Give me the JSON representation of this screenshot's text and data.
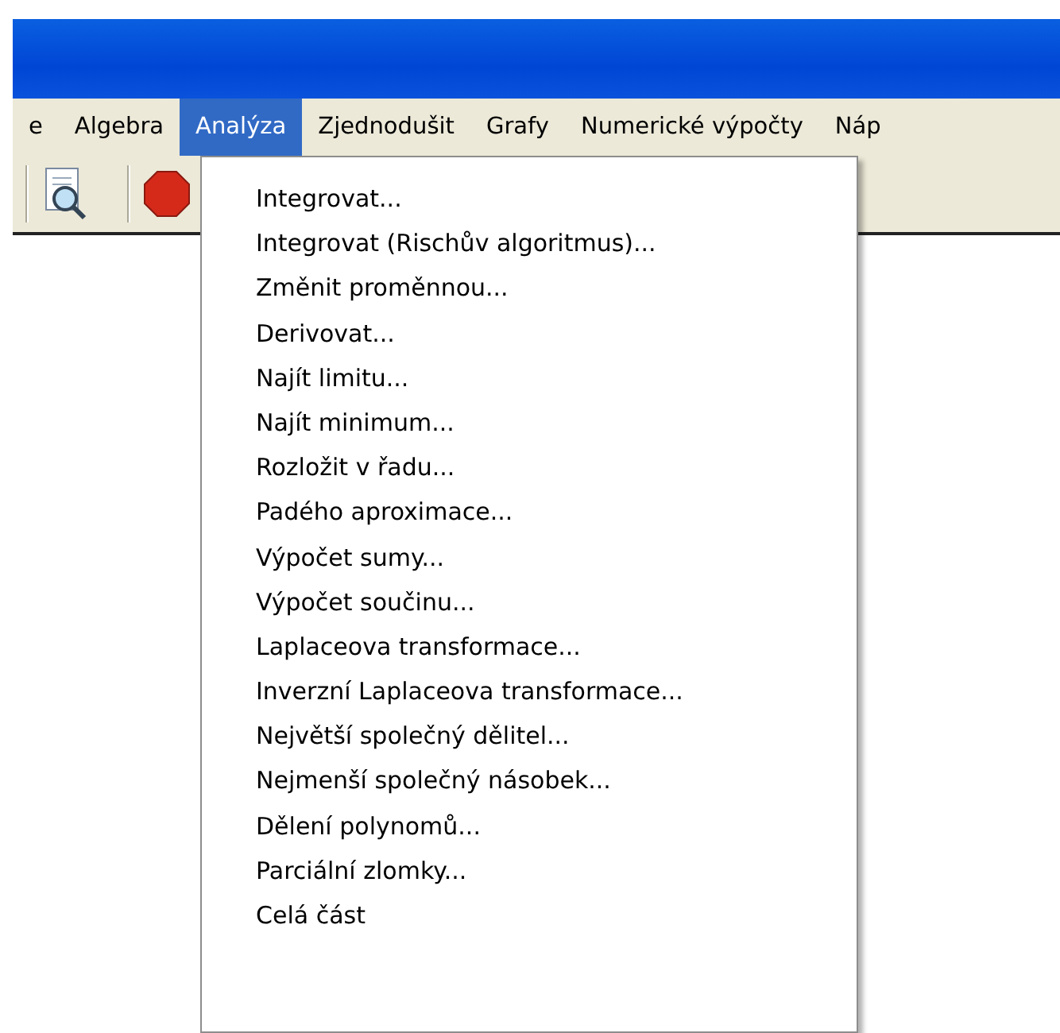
{
  "menu_bar": [
    {
      "label": "e",
      "selected": false
    },
    {
      "label": "Algebra",
      "selected": false
    },
    {
      "label": "Analýza",
      "selected": true
    },
    {
      "label": "Zjednodušit",
      "selected": false
    },
    {
      "label": "Grafy",
      "selected": false
    },
    {
      "label": "Numerické výpočty",
      "selected": false
    },
    {
      "label": "Náp",
      "selected": false
    }
  ],
  "menu": {
    "items": [
      "Integrovat...",
      "Integrovat (Rischův algoritmus)...",
      "Změnit proměnnou...",
      "Derivovat...",
      "Najít limitu...",
      "Najít minimum...",
      "Rozložit v řadu...",
      "Padého aproximace...",
      "Výpočet sumy...",
      "Výpočet součinu...",
      "Laplaceova transformace...",
      "Inverzní Laplaceova transformace...",
      "Největší společný dělitel...",
      "Nejmenší společný násobek...",
      "Dělení polynomů...",
      "Parciální zlomky...",
      "Celá část"
    ]
  }
}
